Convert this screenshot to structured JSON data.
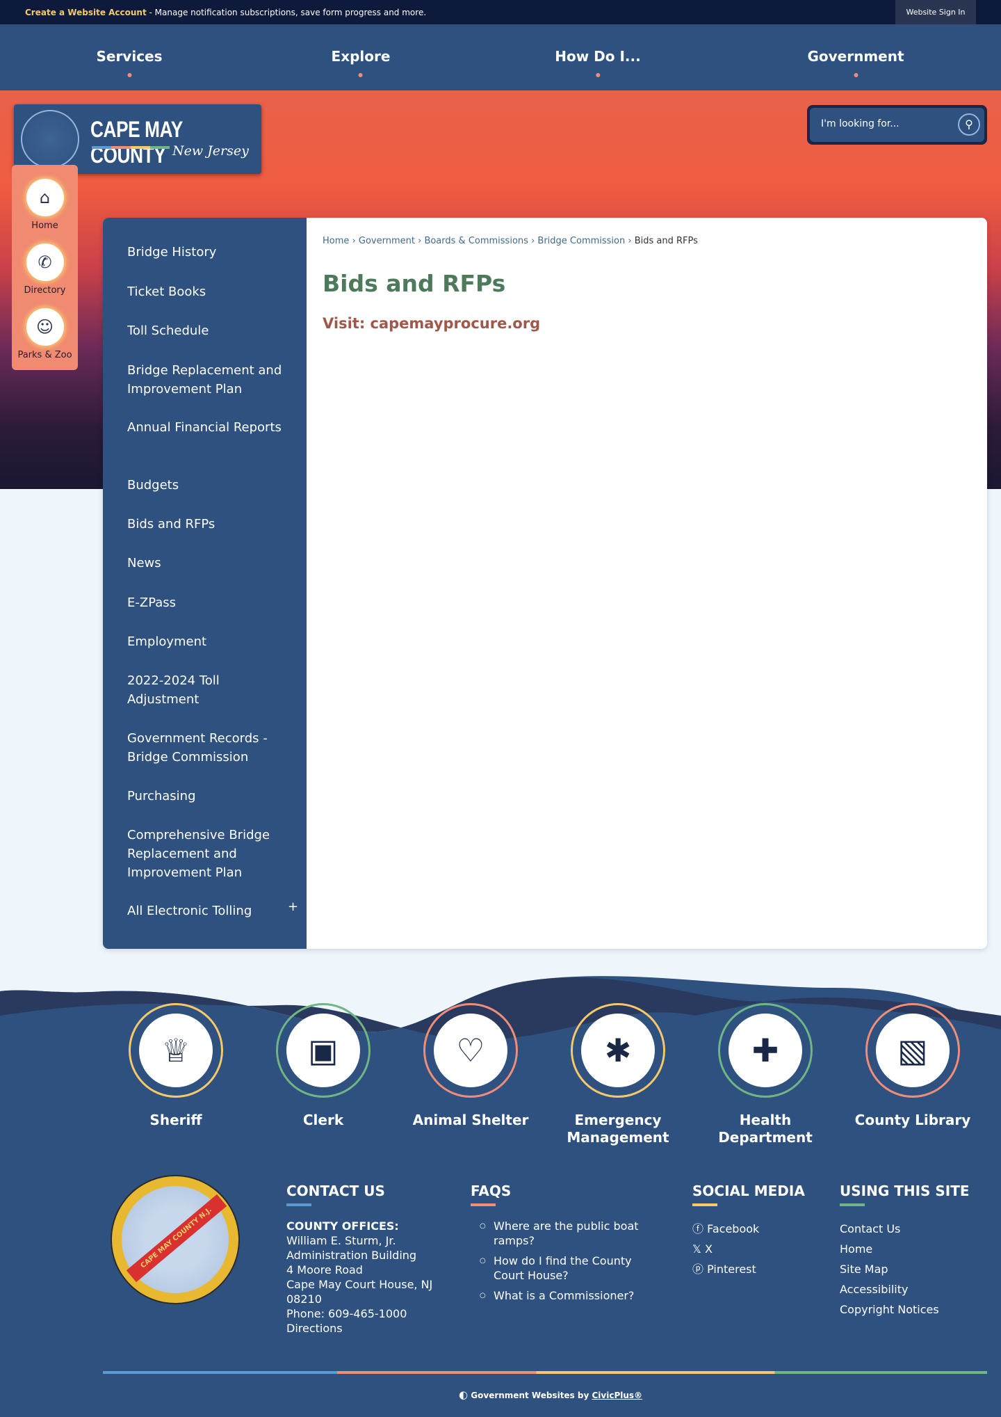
{
  "topbar": {
    "create_account": "Create a Website Account",
    "message": " - Manage notification subscriptions, save form progress and more.",
    "sign_in": "Website Sign In"
  },
  "nav": [
    "Services",
    "Explore",
    "How Do I...",
    "Government"
  ],
  "logo": {
    "title": "CAPE MAY COUNTY",
    "subtitle": "New Jersey"
  },
  "search": {
    "placeholder": "I'm looking for..."
  },
  "quick_links": [
    {
      "label": "Home",
      "icon": "home-icon"
    },
    {
      "label": "Directory",
      "icon": "phone-icon"
    },
    {
      "label": "Parks & Zoo",
      "icon": "lion-icon"
    }
  ],
  "sidebar": [
    "Bridge History",
    "Ticket Books",
    "Toll Schedule",
    "Bridge Replacement and Improvement Plan",
    "Annual Financial Reports",
    "Budgets",
    "Bids and RFPs",
    "News",
    "E-ZPass",
    "Employment",
    "2022-2024 Toll Adjustment",
    "Government Records - Bridge Commission",
    "Purchasing",
    "Comprehensive Bridge Replacement and Improvement Plan",
    "All Electronic Tolling"
  ],
  "sidebar_expand": "+",
  "breadcrumb": [
    "Home",
    "Government",
    "Boards & Commissions",
    "Bridge Commission",
    "Bids and RFPs"
  ],
  "breadcrumb_sep": "›",
  "page": {
    "title": "Bids and RFPs",
    "visit": "Visit: capemayprocure.org"
  },
  "graphic_links": [
    {
      "label": "Sheriff",
      "color": "#f5c96a",
      "icon": "police-hat-icon"
    },
    {
      "label": "Clerk",
      "color": "#6fb585",
      "icon": "file-box-icon"
    },
    {
      "label": "Animal Shelter",
      "color": "#f08d78",
      "icon": "heart-paw-icon"
    },
    {
      "label": "Emergency Management",
      "color": "#f5c96a",
      "icon": "medical-kit-icon"
    },
    {
      "label": "Health Department",
      "color": "#6fb585",
      "icon": "hands-cross-icon"
    },
    {
      "label": "County Library",
      "color": "#f08d78",
      "icon": "books-icon"
    }
  ],
  "footer": {
    "seal_text": "CAPE MAY COUNTY N.J.",
    "contact": {
      "heading": "CONTACT US",
      "label": "COUNTY OFFICES:",
      "lines": [
        "William E. Sturm, Jr.",
        "Administration Building",
        "4 Moore Road",
        "Cape May Court House, NJ",
        "08210",
        "Phone: 609-465-1000",
        "Directions"
      ]
    },
    "faqs": {
      "heading": "FAQS",
      "items": [
        "Where are the public boat ramps?",
        "How do I find the County Court House?",
        "What is a Commissioner?"
      ]
    },
    "social": {
      "heading": "SOCIAL MEDIA",
      "items": [
        "Facebook",
        "X",
        "Pinterest"
      ]
    },
    "site": {
      "heading": "USING THIS SITE",
      "items": [
        "Contact Us",
        "Home",
        "Site Map",
        "Accessibility",
        "Copyright Notices"
      ]
    },
    "civic_prefix": "Government Websites by ",
    "civic_link": "CivicPlus®"
  },
  "colors": {
    "navy": "#2e5180",
    "blue": "#5b9bd1",
    "coral": "#f08d78",
    "yellow": "#f5c96a",
    "green": "#6fb585"
  }
}
